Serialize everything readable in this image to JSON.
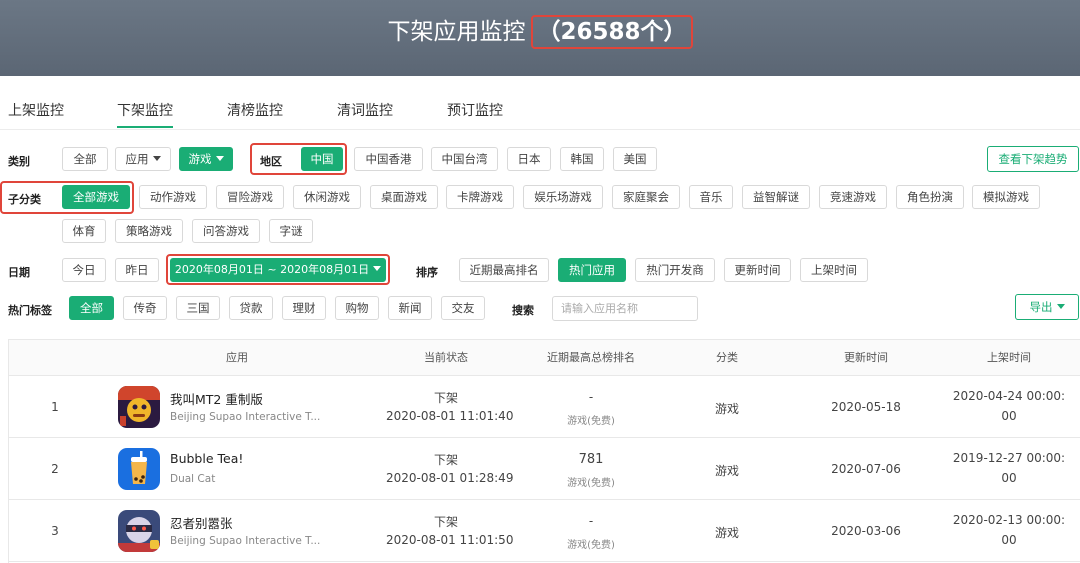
{
  "header": {
    "title": "下架应用监控",
    "count": "（26588个）"
  },
  "tabs": [
    "上架监控",
    "下架监控",
    "清榜监控",
    "清词监控",
    "预订监控"
  ],
  "filters": {
    "category": {
      "label": "类别",
      "options": [
        "全部",
        "应用",
        "游戏"
      ]
    },
    "region": {
      "label": "地区",
      "options": [
        "中国",
        "中国香港",
        "中国台湾",
        "日本",
        "韩国",
        "美国"
      ]
    },
    "trend_button": "查看下架趋势",
    "subcategory": {
      "label": "子分类",
      "options": [
        "全部游戏",
        "动作游戏",
        "冒险游戏",
        "休闲游戏",
        "桌面游戏",
        "卡牌游戏",
        "娱乐场游戏",
        "家庭聚会",
        "音乐",
        "益智解谜",
        "竞速游戏",
        "角色扮演",
        "模拟游戏",
        "体育",
        "策略游戏",
        "问答游戏",
        "字谜"
      ]
    },
    "date": {
      "label": "日期",
      "today": "今日",
      "yesterday": "昨日",
      "range": "2020年08月01日 ~ 2020年08月01日"
    },
    "sort": {
      "label": "排序",
      "options": [
        "近期最高排名",
        "热门应用",
        "热门开发商",
        "更新时间",
        "上架时间"
      ]
    },
    "tags": {
      "label": "热门标签",
      "options": [
        "全部",
        "传奇",
        "三国",
        "贷款",
        "理财",
        "购物",
        "新闻",
        "交友"
      ]
    },
    "search": {
      "label": "搜索",
      "placeholder": "请输入应用名称"
    },
    "export_button": "导出"
  },
  "table": {
    "columns": [
      "应用",
      "当前状态",
      "近期最高总榜排名",
      "分类",
      "更新时间",
      "上架时间"
    ],
    "rows": [
      {
        "rank": "1",
        "name": "我叫MT2 重制版",
        "developer": "Beijing Supao Interactive T...",
        "status": "下架",
        "status_time": "2020-08-01 11:01:40",
        "best_rank": "-",
        "rank_type": "游戏(免费)",
        "category": "游戏",
        "updated": "2020-05-18",
        "released_1": "2020-04-24 00:00:",
        "released_2": "00",
        "icon": "mt2-game-icon"
      },
      {
        "rank": "2",
        "name": "Bubble Tea!",
        "developer": "Dual Cat",
        "status": "下架",
        "status_time": "2020-08-01 01:28:49",
        "best_rank": "781",
        "rank_type": "游戏(免费)",
        "category": "游戏",
        "updated": "2020-07-06",
        "released_1": "2019-12-27 00:00:",
        "released_2": "00",
        "icon": "bubble-tea-icon"
      },
      {
        "rank": "3",
        "name": "忍者别嚣张",
        "developer": "Beijing Supao Interactive T...",
        "status": "下架",
        "status_time": "2020-08-01 11:01:50",
        "best_rank": "-",
        "rank_type": "游戏(免费)",
        "category": "游戏",
        "updated": "2020-03-06",
        "released_1": "2020-02-13 00:00:",
        "released_2": "00",
        "icon": "ninja-game-icon"
      }
    ]
  },
  "colors": {
    "accent": "#1aad75",
    "highlight": "#e0453a",
    "banner": "#5f6a78"
  }
}
